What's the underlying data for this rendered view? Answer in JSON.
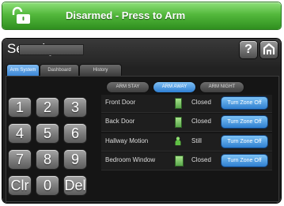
{
  "status_bar": {
    "text": "Disarmed - Press to Arm",
    "color": "#4fb33a",
    "icon": "unlocked-padlock-icon"
  },
  "panel": {
    "title": "Security",
    "help_label": "?",
    "home_icon": "home-icon"
  },
  "tabs": [
    {
      "label": "Arm System",
      "active": true
    },
    {
      "label": "Dashboard",
      "active": false
    },
    {
      "label": "History",
      "active": false
    }
  ],
  "keypad": {
    "display_value": "",
    "keys": [
      "1",
      "2",
      "3",
      "4",
      "5",
      "6",
      "7",
      "8",
      "9",
      "Clr",
      "0",
      "Del"
    ]
  },
  "arm_modes": [
    {
      "label": "ARM STAY",
      "selected": false
    },
    {
      "label": "ARM AWAY",
      "selected": true
    },
    {
      "label": "ARM NIGHT",
      "selected": false
    }
  ],
  "zones": [
    {
      "name": "Front Door",
      "indicator": "door-sensor-icon",
      "status": "Closed",
      "button": "Turn Zone Off"
    },
    {
      "name": "Back Door",
      "indicator": "door-sensor-icon",
      "status": "Closed",
      "button": "Turn Zone Off"
    },
    {
      "name": "Hallway Motion",
      "indicator": "motion-person-icon",
      "status": "Still",
      "button": "Turn Zone Off"
    },
    {
      "name": "Bedroom Window",
      "indicator": "window-sensor-icon",
      "status": "Closed",
      "button": "Turn Zone Off"
    }
  ]
}
